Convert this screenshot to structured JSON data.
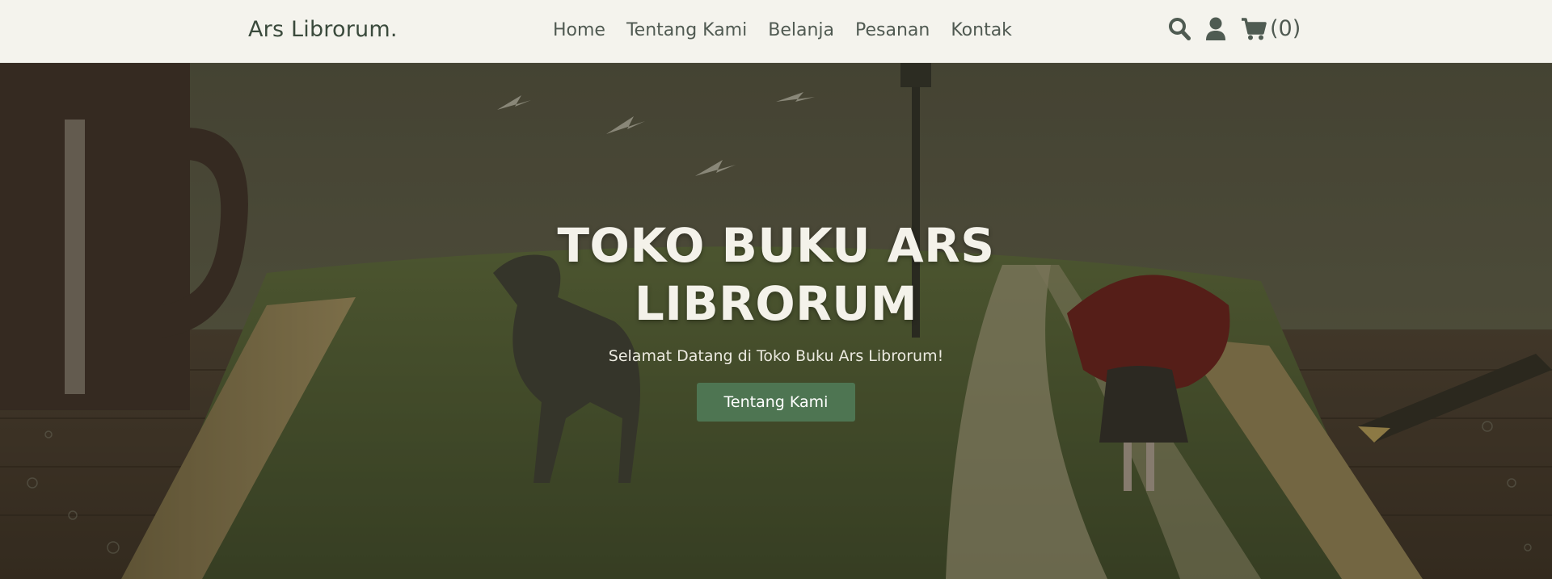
{
  "navbar": {
    "brand": "Ars Librorum.",
    "links": [
      {
        "label": "Home"
      },
      {
        "label": "Tentang Kami"
      },
      {
        "label": "Belanja"
      },
      {
        "label": "Pesanan"
      },
      {
        "label": "Kontak"
      }
    ],
    "icons": [
      "search-icon",
      "user-icon",
      "cart-icon"
    ],
    "cart_count": "(0)"
  },
  "hero": {
    "title": "TOKO BUKU ARS LIBRORUM",
    "subtitle": "Selamat Datang di Toko Buku Ars Librorum!",
    "button_label": "Tentang Kami"
  },
  "colors": {
    "navbar_bg": "#f4f3ed",
    "brand_text": "#3a4a3c",
    "nav_text": "#505a52",
    "button_bg": "#4e7552",
    "hero_title": "#f4f2ea"
  }
}
